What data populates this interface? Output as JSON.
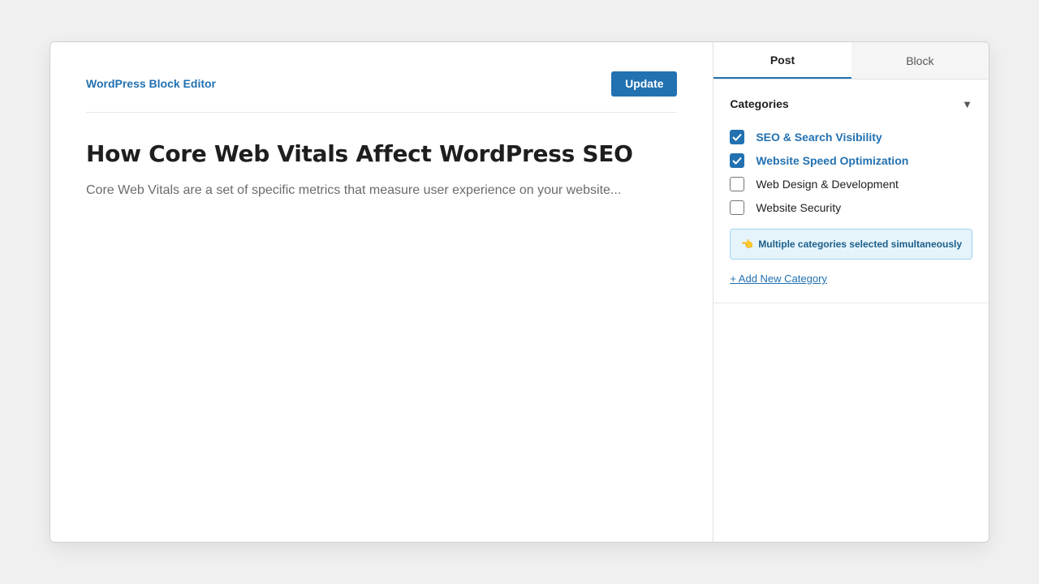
{
  "editor": {
    "brand": "WordPress Block Editor",
    "update_label": "Update",
    "title": "How Core Web Vitals Affect WordPress SEO",
    "excerpt": "Core Web Vitals are a set of specific metrics that measure user experience on your website..."
  },
  "sidebar": {
    "tabs": [
      {
        "label": "Post",
        "active": true
      },
      {
        "label": "Block",
        "active": false
      }
    ],
    "categories": {
      "title": "Categories",
      "caret_icon": "triangle-down-icon",
      "items": [
        {
          "label": "SEO & Search Visibility",
          "checked": true
        },
        {
          "label": "Website Speed Optimization",
          "checked": true
        },
        {
          "label": "Web Design & Development",
          "checked": false
        },
        {
          "label": "Website Security",
          "checked": false
        }
      ],
      "notice_icon": "pointing-hand-icon",
      "notice": "Multiple categories selected simultaneously",
      "add_link": "+ Add New Category"
    }
  },
  "colors": {
    "accent": "#2271b1",
    "notice_bg": "#e5f4fb",
    "notice_border": "#9fd3ef"
  }
}
